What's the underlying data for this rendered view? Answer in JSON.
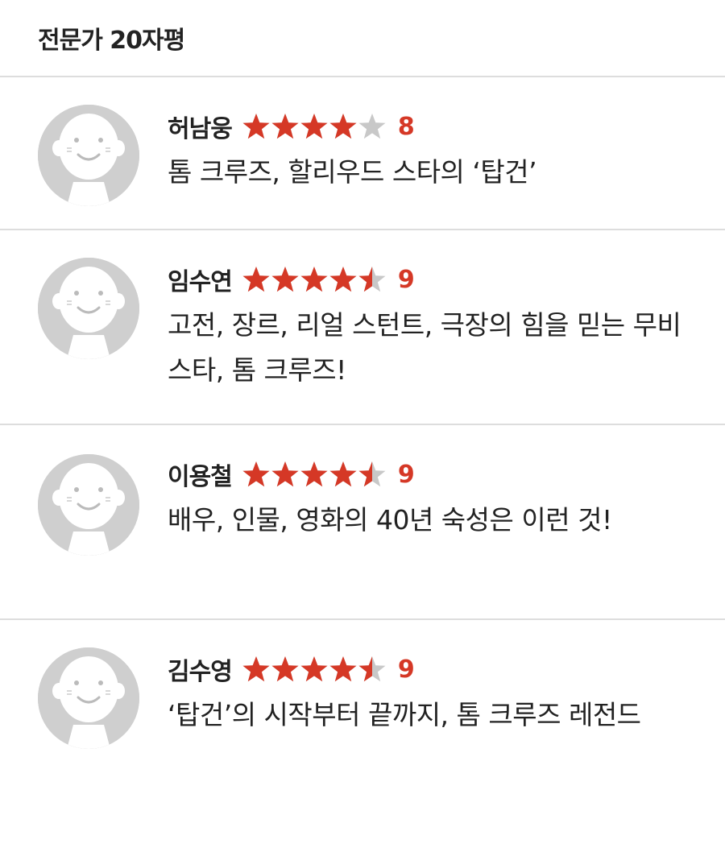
{
  "section": {
    "title": "전문가 20자평"
  },
  "colors": {
    "star_filled": "#d53826",
    "star_empty": "#c8c8c8",
    "score": "#d53826",
    "avatar_bg": "#cfcfcf"
  },
  "reviews": [
    {
      "name": "허남웅",
      "rating_out_of_5": 4,
      "score": "8",
      "comment": "톰 크루즈, 할리우드 스타의 ‘탑건’"
    },
    {
      "name": "임수연",
      "rating_out_of_5": 4.5,
      "score": "9",
      "comment": "고전, 장르, 리얼 스턴트, 극장의 힘을 믿는 무비스타, 톰 크루즈!"
    },
    {
      "name": "이용철",
      "rating_out_of_5": 4.5,
      "score": "9",
      "comment": "배우, 인물, 영화의 40년 숙성은 이런 것!"
    },
    {
      "name": "김수영",
      "rating_out_of_5": 4.5,
      "score": "9",
      "comment": "‘탑건’의 시작부터 끝까지, 톰 크루즈 레전드"
    }
  ]
}
